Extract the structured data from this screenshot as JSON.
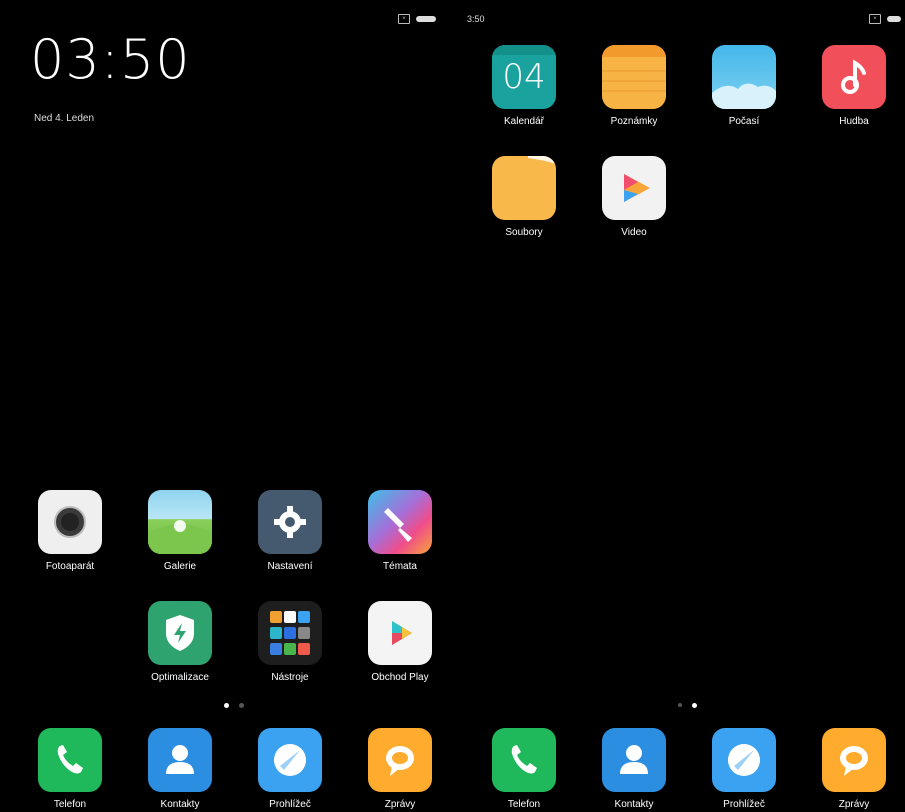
{
  "status_bar": {
    "left_time": "",
    "right_time": "3:50"
  },
  "lock_widget": {
    "time": "03:50",
    "date": "Ned 4. Leden"
  },
  "left_screen": {
    "apps_row1": [
      "Fotoaparát",
      "Galerie",
      "Nastavení",
      "Témata"
    ],
    "apps_row2": [
      "Optimalizace",
      "Nástroje",
      "Obchod Play"
    ],
    "page_dots": {
      "active": 0,
      "count": 2
    },
    "dock": [
      "Telefon",
      "Kontakty",
      "Prohlížeč",
      "Zprávy"
    ]
  },
  "right_screen": {
    "calendar_day": "04",
    "apps_row1": [
      "Kalendář",
      "Poznámky",
      "Počasí",
      "Hudba"
    ],
    "apps_row2": [
      "Soubory",
      "Video"
    ],
    "page_dots": {
      "active": 1,
      "count": 2
    },
    "dock": [
      "Telefon",
      "Kontakty",
      "Prohlížeč",
      "Zprávy"
    ]
  },
  "colors": {
    "calendar": "#1aa39e",
    "notes": "#f7b344",
    "weather": "#5cc6ee",
    "music": "#f1505b",
    "files": "#f8b94a",
    "video": "#f2f2f2",
    "camera": "#eeeeee",
    "gallery": "#7fcf5a",
    "settings": "#465a6f",
    "themes": "#e8559f",
    "security": "#2ea36f",
    "tools": "#2a2a2a",
    "play": "#f4f4f4",
    "phone": "#1fb85a",
    "contacts": "#2b8ee1",
    "browser": "#3aa2f0",
    "messages": "#ffab2e"
  }
}
